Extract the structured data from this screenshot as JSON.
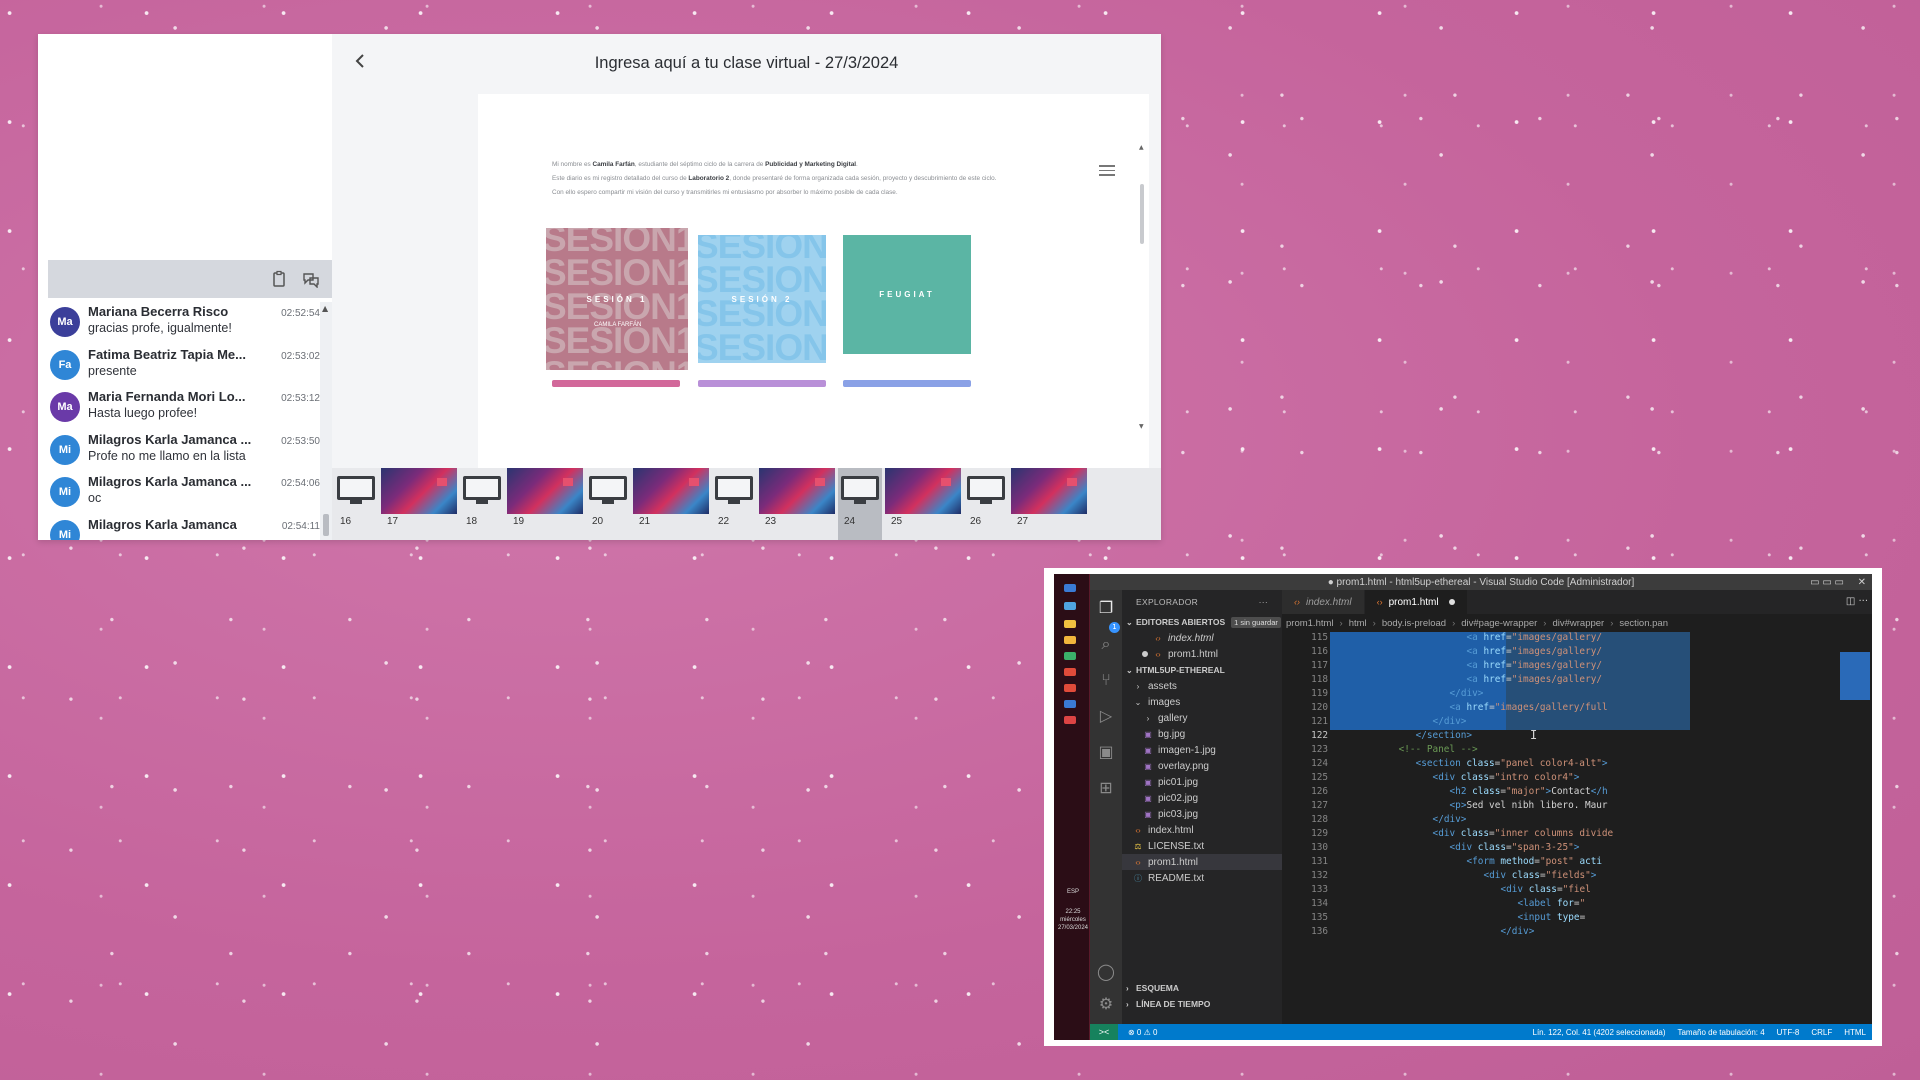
{
  "virtual_class": {
    "title": "Ingresa aquí a tu clase virtual - 27/3/2024",
    "back_icon": "chevron-left-icon",
    "chat_toolbar_icons": [
      "clipboard-icon",
      "chat-bubbles-icon"
    ],
    "chat": [
      {
        "initials": "Ma",
        "color": "#3b3f9a",
        "name": "Mariana Becerra Risco",
        "time": "02:52:54",
        "text": "gracias profe, igualmente!"
      },
      {
        "initials": "Fa",
        "color": "#2f86d6",
        "name": "Fatima Beatriz Tapia Me...",
        "time": "02:53:02",
        "text": "presente"
      },
      {
        "initials": "Ma",
        "color": "#6a3aa8",
        "name": "Maria Fernanda Mori Lo...",
        "time": "02:53:12",
        "text": "Hasta luego profee!"
      },
      {
        "initials": "Mi",
        "color": "#2f86d6",
        "name": "Milagros Karla Jamanca ...",
        "time": "02:53:50",
        "text": "Profe no me llamo en la lista"
      },
      {
        "initials": "Mi",
        "color": "#2f86d6",
        "name": "Milagros Karla Jamanca ...",
        "time": "02:54:06",
        "text": "oc"
      },
      {
        "initials": "Mi",
        "color": "#2f86d6",
        "name": "Milagros Karla Jamanca",
        "time": "02:54:11",
        "text": ""
      }
    ],
    "slide": {
      "intro_pre": "Mi nombre es ",
      "intro_name": "Camila Farfán",
      "intro_mid": ", estudiante del séptimo ciclo de la carrera de ",
      "intro_career": "Publicidad y Marketing Digital",
      "intro_end": ".",
      "line2_pre": "Este diario es mi registro detallado del curso de ",
      "line2_course": "Laboratorio 2",
      "line2_end": ", donde presentaré de forma organizada cada sesión, proyecto y descubrimiento de este ciclo.",
      "line3": "Con ello espero compartir mi visión del curso y transmitirles mi entusiasmo por absorber lo máximo posible de cada clase.",
      "tiles": [
        {
          "caption": "SESIÓN 1",
          "bg_word": "SESION1",
          "sub": "CAMILA FARFÁN"
        },
        {
          "caption": "SESIÓN 2",
          "bg_word": "SESION2"
        },
        {
          "caption": "FEUGIAT"
        }
      ]
    },
    "thumbnails": [
      {
        "num": "16",
        "kind": "monitor"
      },
      {
        "num": "17",
        "kind": "art"
      },
      {
        "num": "18",
        "kind": "monitor"
      },
      {
        "num": "19",
        "kind": "art"
      },
      {
        "num": "20",
        "kind": "monitor"
      },
      {
        "num": "21",
        "kind": "art"
      },
      {
        "num": "22",
        "kind": "monitor"
      },
      {
        "num": "23",
        "kind": "art"
      },
      {
        "num": "24",
        "kind": "monitor",
        "active": true
      },
      {
        "num": "25",
        "kind": "art"
      },
      {
        "num": "26",
        "kind": "monitor"
      },
      {
        "num": "27",
        "kind": "art"
      }
    ]
  },
  "vscode": {
    "window_title": "● prom1.html - html5up-ethereal - Visual Studio Code [Administrador]",
    "explorer_title": "EXPLORADOR",
    "explorer_more": "···",
    "open_editors_label": "EDITORES ABIERTOS",
    "open_editors_badge": "1 sin guardar",
    "open_editors": [
      {
        "name": "index.html",
        "italic": true,
        "dirty": false
      },
      {
        "name": "prom1.html",
        "italic": false,
        "dirty": true
      }
    ],
    "project_label": "HTML5UP-ETHEREAL",
    "tree": [
      {
        "name": "assets",
        "type": "folder",
        "depth": 1,
        "open": false
      },
      {
        "name": "images",
        "type": "folder",
        "depth": 1,
        "open": true
      },
      {
        "name": "gallery",
        "type": "folder",
        "depth": 2,
        "open": false
      },
      {
        "name": "bg.jpg",
        "type": "image",
        "depth": 2
      },
      {
        "name": "imagen-1.jpg",
        "type": "image",
        "depth": 2
      },
      {
        "name": "overlay.png",
        "type": "image",
        "depth": 2
      },
      {
        "name": "pic01.jpg",
        "type": "image",
        "depth": 2
      },
      {
        "name": "pic02.jpg",
        "type": "image",
        "depth": 2
      },
      {
        "name": "pic03.jpg",
        "type": "image",
        "depth": 2
      },
      {
        "name": "index.html",
        "type": "html",
        "depth": 1
      },
      {
        "name": "LICENSE.txt",
        "type": "license",
        "depth": 1
      },
      {
        "name": "prom1.html",
        "type": "html",
        "depth": 1,
        "selected": true
      },
      {
        "name": "README.txt",
        "type": "info",
        "depth": 1
      }
    ],
    "outline_label": "ESQUEMA",
    "timeline_label": "LÍNEA DE TIEMPO",
    "tabs": [
      {
        "name": "index.html",
        "active": false,
        "italic": true,
        "dirty": false
      },
      {
        "name": "prom1.html",
        "active": true,
        "italic": false,
        "dirty": true
      }
    ],
    "breadcrumbs": [
      "prom1.html",
      "html",
      "body.is-preload",
      "div#page-wrapper",
      "div#wrapper",
      "section.pan"
    ],
    "code_lines": [
      {
        "n": "115",
        "html": "<span class='tg'>&lt;a</span> <span class='at'>href</span>=<span class='st'>\"images/gallery/</span>",
        "indent": 22
      },
      {
        "n": "116",
        "html": "<span class='tg'>&lt;a</span> <span class='at'>href</span>=<span class='st'>\"images/gallery/</span>",
        "indent": 22
      },
      {
        "n": "117",
        "html": "<span class='tg'>&lt;a</span> <span class='at'>href</span>=<span class='st'>\"images/gallery/</span>",
        "indent": 22
      },
      {
        "n": "118",
        "html": "<span class='tg'>&lt;a</span> <span class='at'>href</span>=<span class='st'>\"images/gallery/</span>",
        "indent": 22
      },
      {
        "n": "119",
        "html": "<span class='tg'>&lt;/div&gt;</span>",
        "indent": 19
      },
      {
        "n": "120",
        "html": "<span class='tg'>&lt;a</span> <span class='at'>href</span>=<span class='st'>\"images/gallery/full</span>",
        "indent": 19
      },
      {
        "n": "121",
        "html": "<span class='tg'>&lt;/div&gt;</span>",
        "indent": 16
      },
      {
        "n": "122",
        "html": "<span class='tg'>&lt;/section&gt;</span>",
        "indent": 13
      },
      {
        "n": "123",
        "html": "<span class='cm'>&lt;!-- Panel --&gt;</span>",
        "indent": 10
      },
      {
        "n": "124",
        "html": "<span class='tg'>&lt;section</span> <span class='at'>class</span>=<span class='st'>\"panel color4-alt\"</span><span class='tg'>&gt;</span>",
        "indent": 13
      },
      {
        "n": "125",
        "html": "<span class='tg'>&lt;div</span> <span class='at'>class</span>=<span class='st'>\"intro color4\"</span><span class='tg'>&gt;</span>",
        "indent": 16
      },
      {
        "n": "126",
        "html": "<span class='tg'>&lt;h2</span> <span class='at'>class</span>=<span class='st'>\"major\"</span><span class='tg'>&gt;</span><span class='tx'>Contact</span><span class='tg'>&lt;/h</span>",
        "indent": 19
      },
      {
        "n": "127",
        "html": "<span class='tg'>&lt;p&gt;</span><span class='tx'>Sed vel nibh libero. Maur</span>",
        "indent": 19
      },
      {
        "n": "128",
        "html": "<span class='tg'>&lt;/div&gt;</span>",
        "indent": 16
      },
      {
        "n": "129",
        "html": "<span class='tg'>&lt;div</span> <span class='at'>class</span>=<span class='st'>\"inner columns divide</span>",
        "indent": 16
      },
      {
        "n": "130",
        "html": "<span class='tg'>&lt;div</span> <span class='at'>class</span>=<span class='st'>\"span-3-25\"</span><span class='tg'>&gt;</span>",
        "indent": 19
      },
      {
        "n": "131",
        "html": "<span class='tg'>&lt;form</span> <span class='at'>method</span>=<span class='st'>\"post\"</span> <span class='at'>acti</span>",
        "indent": 22
      },
      {
        "n": "132",
        "html": "<span class='tg'>&lt;div</span> <span class='at'>class</span>=<span class='st'>\"fields\"</span><span class='tg'>&gt;</span>",
        "indent": 25
      },
      {
        "n": "133",
        "html": "<span class='tg'>&lt;div</span> <span class='at'>class</span>=<span class='st'>\"fiel</span>",
        "indent": 28
      },
      {
        "n": "134",
        "html": "<span class='tg'>&lt;label</span> <span class='at'>for</span>=<span class='st'>\"</span>",
        "indent": 31
      },
      {
        "n": "135",
        "html": "<span class='tg'>&lt;input</span> <span class='at'>type</span>=",
        "indent": 31
      },
      {
        "n": "136",
        "html": "<span class='tg'>&lt;/div&gt;</span>",
        "indent": 28
      }
    ],
    "current_line": "122",
    "status_remote": "><",
    "status_problems": "⊗ 0 ⚠ 0",
    "status_right": [
      "Lín. 122, Col. 41 (4202 seleccionada)",
      "Tamaño de tabulación: 4",
      "UTF-8",
      "CRLF",
      "HTML"
    ],
    "taskbar_lang": "ESP",
    "taskbar_time": "22:25",
    "taskbar_day": "miércoles",
    "taskbar_date": "27/03/2024"
  }
}
